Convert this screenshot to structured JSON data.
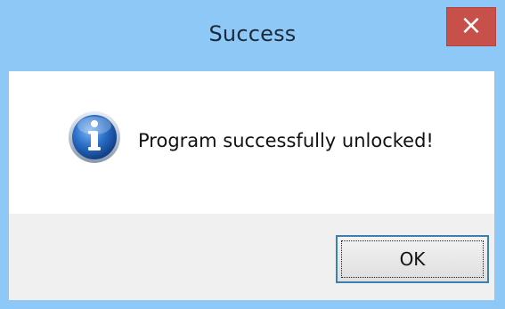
{
  "dialog": {
    "title": "Success",
    "close_glyph": "×",
    "message": "Program successfully unlocked!",
    "icon": "info-icon",
    "ok_label": "OK"
  },
  "colors": {
    "titlebar": "#8ec8f7",
    "close_button": "#c7504b",
    "content_background": "#ffffff",
    "footer_background": "#f0f0f0",
    "button_border": "#3c7fb1"
  }
}
